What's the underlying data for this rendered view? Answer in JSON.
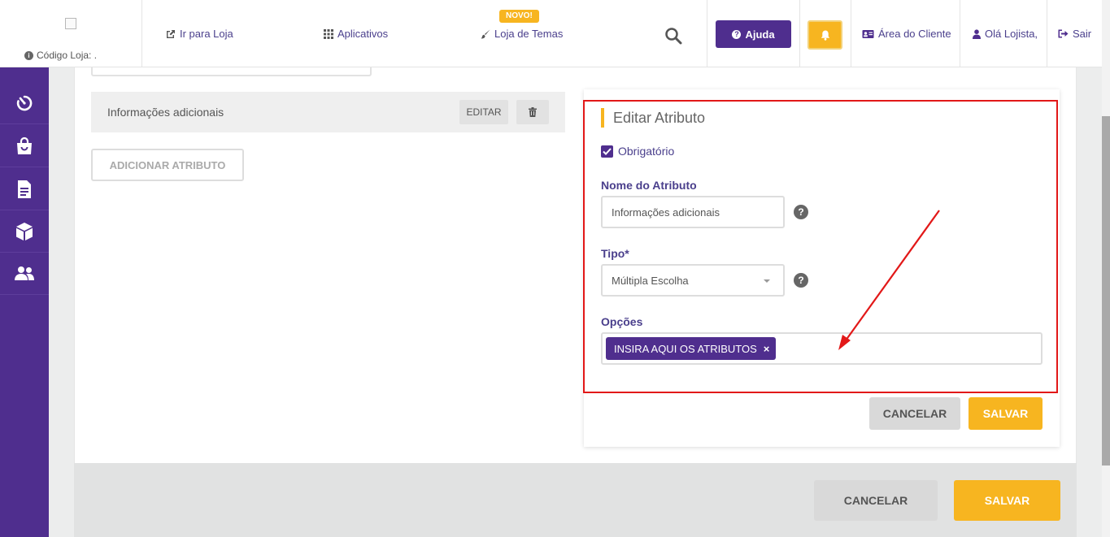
{
  "header": {
    "store_code_label": "Código Loja: .",
    "links": {
      "go_to_store": "Ir para Loja",
      "apps": "Aplicativos",
      "theme_store": "Loja de Temas",
      "client_area": "Área do Cliente",
      "greeting": "Olá Lojista,",
      "logout": "Sair"
    },
    "new_badge": "NOVO!",
    "help_button": "Ajuda"
  },
  "sidebar": {
    "items": [
      "dashboard-icon",
      "bag-icon",
      "document-icon",
      "box-icon",
      "users-icon"
    ]
  },
  "attributes": {
    "row_name": "Informações adicionais",
    "edit_label": "EDITAR",
    "add_button": "ADICIONAR ATRIBUTO"
  },
  "edit_panel": {
    "title": "Editar Atributo",
    "required_label": "Obrigatório",
    "required_checked": true,
    "name_label": "Nome do Atributo",
    "name_value": "Informações adicionais",
    "type_label": "Tipo*",
    "type_value": "Múltipla Escolha",
    "options_label": "Opções",
    "option_tag": "INSIRA AQUI OS ATRIBUTOS",
    "cancel": "CANCELAR",
    "save": "SALVAR"
  },
  "footer": {
    "cancel": "CANCELAR",
    "save": "SALVAR"
  },
  "colors": {
    "brand_purple": "#4f2e8e",
    "accent_yellow": "#f7b520",
    "annotation_red": "#e21818"
  }
}
